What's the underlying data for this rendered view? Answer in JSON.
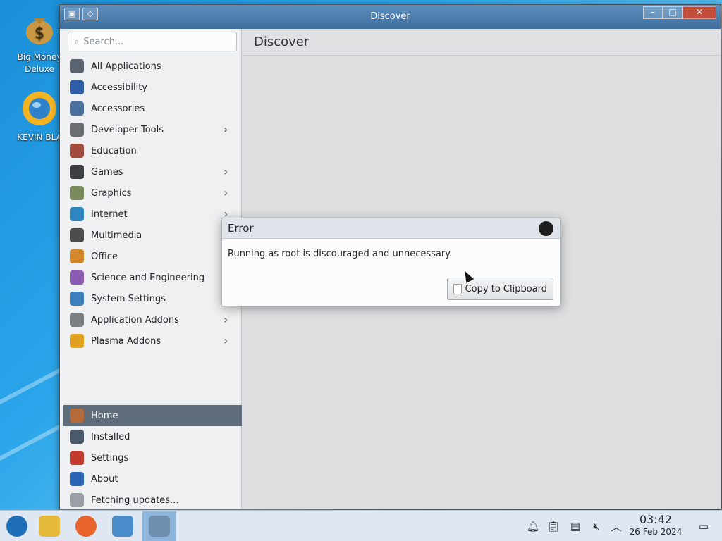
{
  "desktop": {
    "icons": [
      {
        "label": "Big Money\nDeluxe",
        "icon": "money-bag-icon"
      },
      {
        "label": "KEVIN BLA",
        "icon": "sun-globe-icon"
      }
    ]
  },
  "window": {
    "title": "Discover",
    "titlebar_buttons": [
      "app-menu-icon",
      "pin-icon"
    ],
    "controls": [
      "minimize-icon",
      "maximize-icon",
      "close-icon"
    ]
  },
  "sidebar": {
    "search": {
      "placeholder": "Search..."
    },
    "categories": [
      {
        "label": "All Applications",
        "icon": "all-apps-icon",
        "color": "#5a6470",
        "submenu": false
      },
      {
        "label": "Accessibility",
        "icon": "accessibility-icon",
        "color": "#2f5ea8",
        "submenu": false
      },
      {
        "label": "Accessories",
        "icon": "accessories-icon",
        "color": "#4a6f9d",
        "submenu": false
      },
      {
        "label": "Developer Tools",
        "icon": "developer-tools-icon",
        "color": "#6a6e73",
        "submenu": true
      },
      {
        "label": "Education",
        "icon": "education-icon",
        "color": "#a04b3d",
        "submenu": false
      },
      {
        "label": "Games",
        "icon": "games-icon",
        "color": "#3b3f44",
        "submenu": true
      },
      {
        "label": "Graphics",
        "icon": "graphics-icon",
        "color": "#7b8a5a",
        "submenu": true
      },
      {
        "label": "Internet",
        "icon": "internet-icon",
        "color": "#2e86c1",
        "submenu": true
      },
      {
        "label": "Multimedia",
        "icon": "multimedia-icon",
        "color": "#4c4c4c",
        "submenu": false
      },
      {
        "label": "Office",
        "icon": "office-icon",
        "color": "#d3882b",
        "submenu": false
      },
      {
        "label": "Science and Engineering",
        "icon": "science-icon",
        "color": "#8a5bb0",
        "submenu": false
      },
      {
        "label": "System Settings",
        "icon": "system-settings-icon",
        "color": "#3e7fbf",
        "submenu": false
      },
      {
        "label": "Application Addons",
        "icon": "application-addons-icon",
        "color": "#7a7f84",
        "submenu": true
      },
      {
        "label": "Plasma Addons",
        "icon": "plasma-addons-icon",
        "color": "#e0a020",
        "submenu": true
      }
    ],
    "bottom": [
      {
        "label": "Home",
        "icon": "home-icon",
        "color": "#b56a3a",
        "active": true
      },
      {
        "label": "Installed",
        "icon": "installed-icon",
        "color": "#4a5a6b",
        "active": false
      },
      {
        "label": "Settings",
        "icon": "settings-icon",
        "color": "#c0392b",
        "active": false
      },
      {
        "label": "About",
        "icon": "about-icon",
        "color": "#2c64b5",
        "active": false
      },
      {
        "label": "Fetching updates...",
        "icon": "updates-icon",
        "color": "#9aa0a6",
        "active": false
      }
    ]
  },
  "main": {
    "title": "Discover"
  },
  "dialog": {
    "title": "Error",
    "message": "Running as root is discouraged and unnecessary.",
    "button_label": "Copy to Clipboard"
  },
  "taskbar": {
    "apps": [
      {
        "name": "start-menu-icon",
        "color": "#1f6fb8",
        "active": false
      },
      {
        "name": "file-manager-icon",
        "color": "#e5b93a",
        "active": false
      },
      {
        "name": "firefox-icon",
        "color": "#e8622c",
        "active": false
      },
      {
        "name": "system-monitor-icon",
        "color": "#4a8cc9",
        "active": false
      },
      {
        "name": "discover-icon",
        "color": "#6e8fae",
        "active": true
      }
    ],
    "tray": [
      "notifications-icon",
      "clipboard-icon",
      "device-icon",
      "volume-muted-icon",
      "tray-expand-icon"
    ],
    "clock": {
      "time": "03:42",
      "date": "26 Feb 2024"
    },
    "show_desktop": "show-desktop-icon"
  }
}
